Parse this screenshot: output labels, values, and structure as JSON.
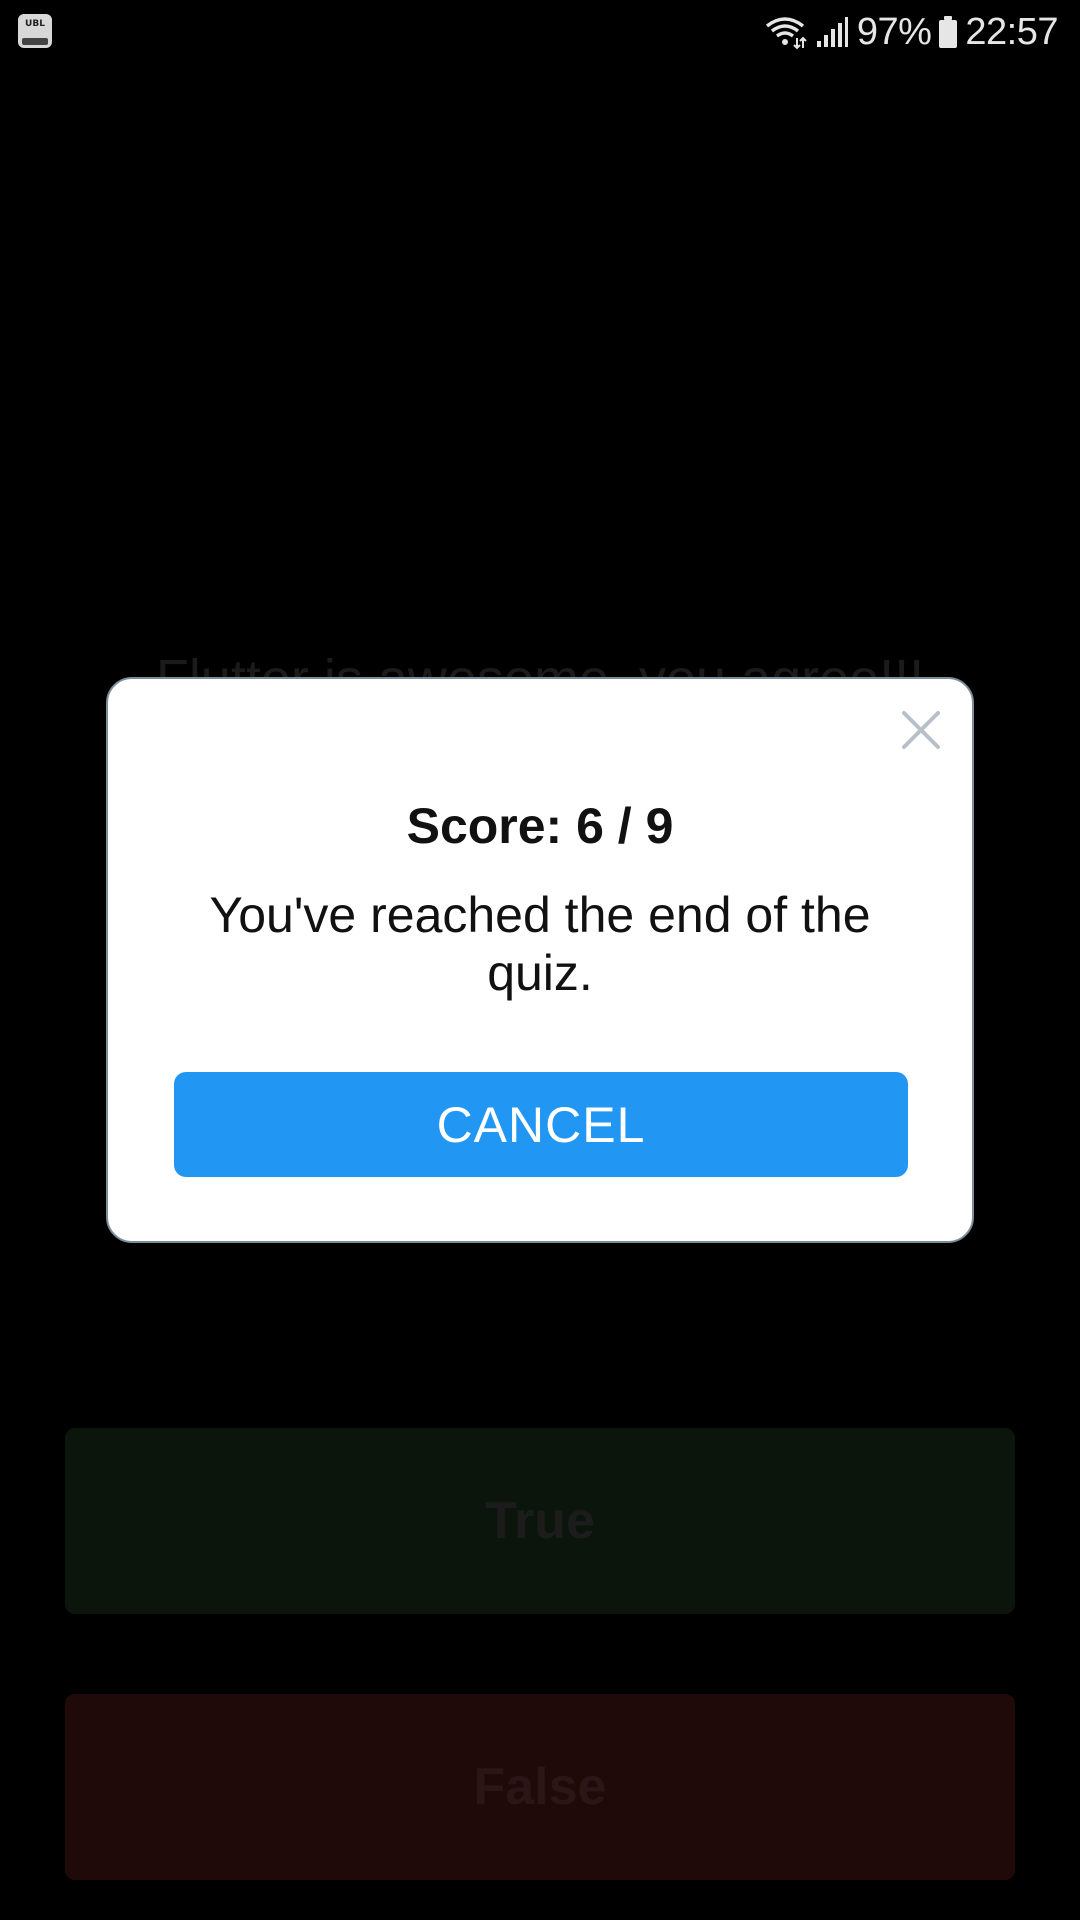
{
  "status_bar": {
    "battery_percent": "97%",
    "time": "22:57",
    "app_icon_text": "UBL",
    "icons": [
      "wifi-icon",
      "signal-icon",
      "battery-icon"
    ]
  },
  "quiz": {
    "question": "Flutter is awesome, you agree!!!",
    "true_label": "True",
    "false_label": "False"
  },
  "dialog": {
    "score": "Score: 6 / 9",
    "message": "You've reached the end of the quiz.",
    "cancel_label": "CANCEL",
    "close_icon": "close-icon"
  },
  "colors": {
    "cancel_button": "#2196f3",
    "true_button": "#0b150b",
    "false_button": "#200909"
  }
}
